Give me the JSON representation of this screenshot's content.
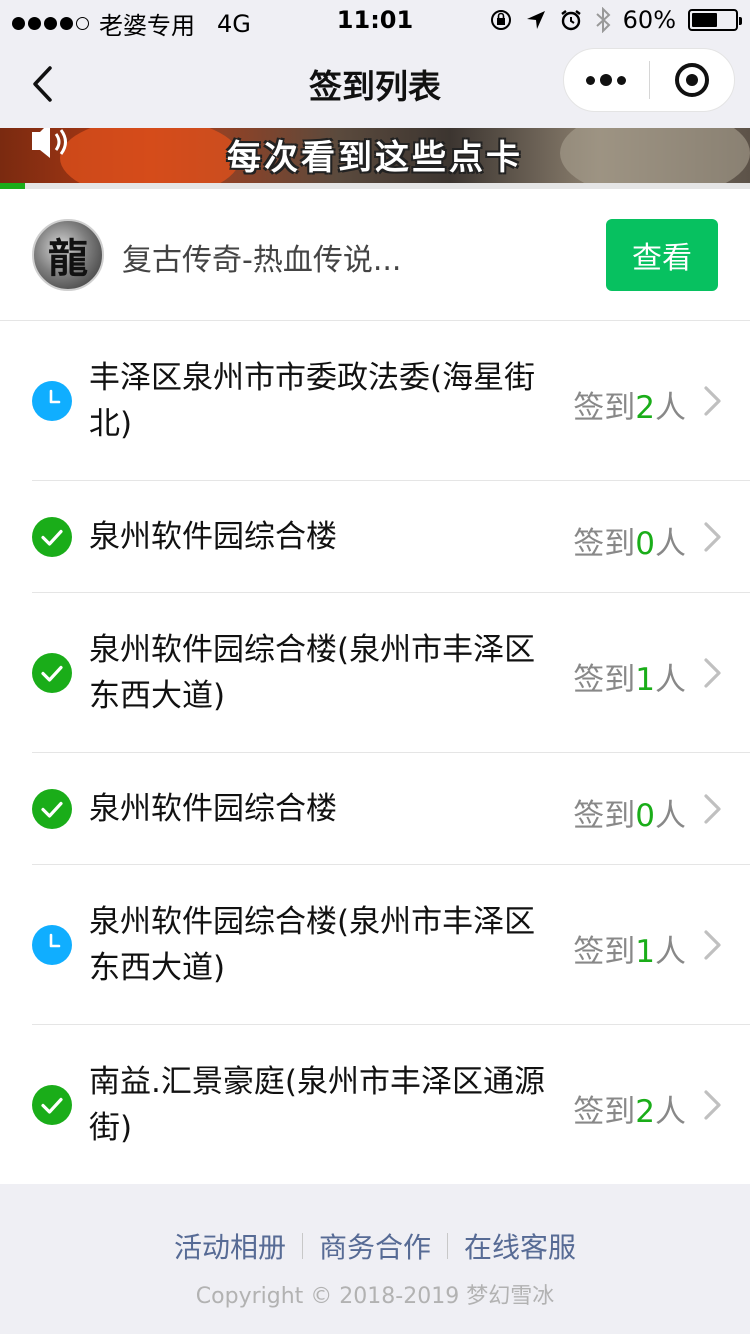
{
  "status_bar": {
    "carrier": "老婆专用",
    "network": "4G",
    "time": "11:01",
    "battery": "60%",
    "battery_level": 0.6
  },
  "nav": {
    "title": "签到列表"
  },
  "video": {
    "subtitle": "每次看到这些点卡",
    "progress": 0.033
  },
  "promo": {
    "title": "复古传奇-热血传说...",
    "view_label": "查看",
    "avatar_glyph": "龍"
  },
  "checkin_prefix": "签到",
  "checkin_suffix": "人",
  "items": [
    {
      "name": "丰泽区泉州市市委政法委(海星街北)",
      "count": "2",
      "status": "pending"
    },
    {
      "name": "泉州软件园综合楼",
      "count": "0",
      "status": "done"
    },
    {
      "name": "泉州软件园综合楼(泉州市丰泽区东西大道)",
      "count": "1",
      "status": "done"
    },
    {
      "name": "泉州软件园综合楼",
      "count": "0",
      "status": "done"
    },
    {
      "name": "泉州软件园综合楼(泉州市丰泽区东西大道)",
      "count": "1",
      "status": "pending"
    },
    {
      "name": "南益.汇景豪庭(泉州市丰泽区通源街)",
      "count": "2",
      "status": "done"
    }
  ],
  "footer": {
    "links": [
      "活动相册",
      "商务合作",
      "在线客服"
    ],
    "copyright": "Copyright © 2018-2019 梦幻雪冰"
  },
  "colors": {
    "accent_green": "#1aad19",
    "button_green": "#07c160",
    "pending_blue": "#10aeff",
    "link_blue": "#576b95"
  }
}
